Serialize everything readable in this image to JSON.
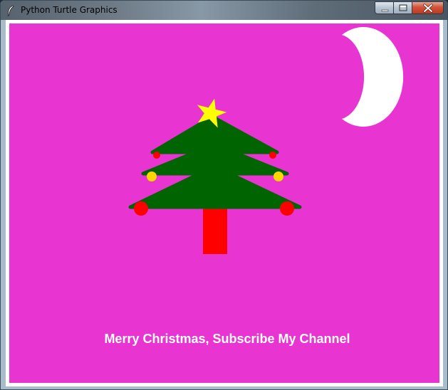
{
  "window": {
    "title": "Python Turtle Graphics",
    "icon": "feather-icon",
    "controls": {
      "minimize": "minimize-icon",
      "maximize": "maximize-icon",
      "close": "close-icon"
    }
  },
  "scene": {
    "background_color": "#e834d0",
    "message": "Merry Christmas, Subscribe My Channel",
    "message_color": "#ffffff",
    "tree_color": "#006400",
    "trunk_color": "#ff0000",
    "star_color": "#ffff00",
    "moon_color": "#ffffff",
    "ornaments": [
      {
        "color": "#ff0000"
      },
      {
        "color": "#ff0000"
      },
      {
        "color": "#ffd700"
      },
      {
        "color": "#ffd700"
      },
      {
        "color": "#ff0000"
      },
      {
        "color": "#ff0000"
      }
    ]
  }
}
